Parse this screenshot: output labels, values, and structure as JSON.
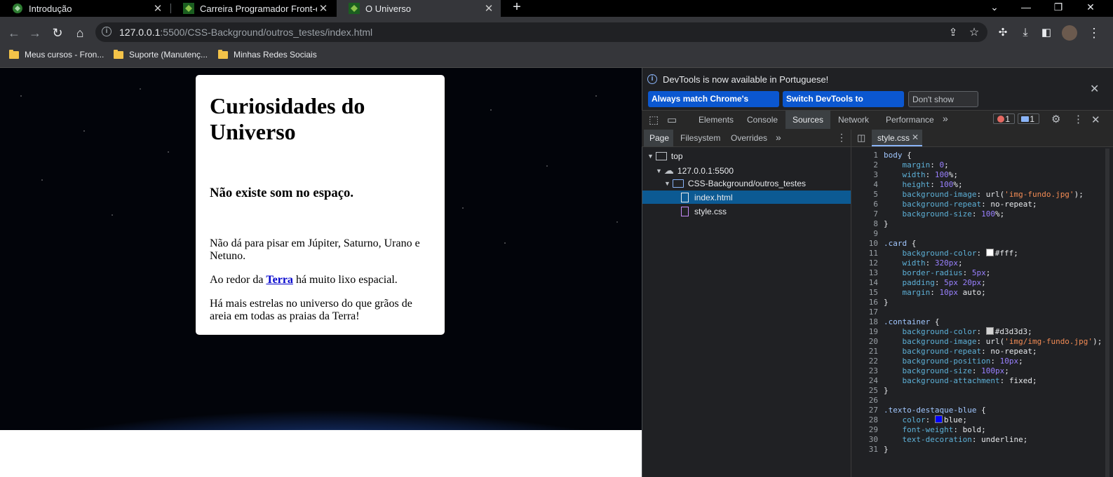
{
  "tabs": [
    {
      "title": "Introdução",
      "active": false
    },
    {
      "title": "Carreira Programador Front-end",
      "active": false
    },
    {
      "title": "O Universo",
      "active": true
    }
  ],
  "new_tab": "+",
  "address": {
    "host": "127.0.0.1",
    "rest": ":5500/CSS-Background/outros_testes/index.html"
  },
  "bookmarks": [
    "Meus cursos - Fron...",
    "Suporte (Manutenç...",
    "Minhas Redes Sociais"
  ],
  "page": {
    "title": "Curiosidades do Universo",
    "subtitle": "Não existe som no espaço.",
    "p1": "Não dá para pisar em Júpiter, Saturno, Urano e Netuno.",
    "p2_before": "Ao redor da ",
    "p2_link": "Terra",
    "p2_after": " há muito lixo espacial.",
    "p3": "Há mais estrelas no universo do que grãos de areia em todas as praias da Terra!"
  },
  "devtools": {
    "infobar": "DevTools is now available in Portuguese!",
    "btn_match": "Always match Chrome's language",
    "btn_switch": "Switch DevTools to Portuguese",
    "btn_dont": "Don't show again",
    "tabs": [
      "Elements",
      "Console",
      "Sources",
      "Network",
      "Performance"
    ],
    "active_tab": "Sources",
    "errors": "1",
    "messages": "1",
    "panel_tabs": [
      "Page",
      "Filesystem",
      "Overrides"
    ],
    "tree": {
      "top": "top",
      "host": "127.0.0.1:5500",
      "folder": "CSS-Background/outros_testes",
      "file1": "index.html",
      "file2": "style.css"
    },
    "editor_tab": "style.css",
    "code": [
      "body {",
      "    margin: 0;",
      "    width: 100%;",
      "    height: 100%;",
      "    background-image: url('img-fundo.jpg');",
      "    background-repeat: no-repeat;",
      "    background-size: 100%;",
      "}",
      "",
      ".card {",
      "    background-color: #fff;",
      "    width: 320px;",
      "    border-radius: 5px;",
      "    padding: 5px 20px;",
      "    margin: 10px auto;",
      "}",
      "",
      ".container {",
      "    background-color: #d3d3d3;",
      "    background-image: url('img/img-fundo.jpg');",
      "    background-repeat: no-repeat;",
      "    background-position: 10px;",
      "    background-size: 100px;",
      "    background-attachment: fixed;",
      "}",
      "",
      ".texto-destaque-blue {",
      "    color: blue;",
      "    font-weight: bold;",
      "    text-decoration: underline;",
      "}"
    ]
  }
}
